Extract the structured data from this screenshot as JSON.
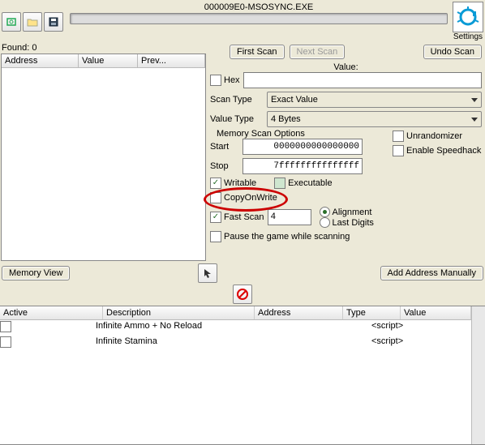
{
  "title": "000009E0-MSOSYNC.EXE",
  "found_label": "Found:",
  "found_count": "0",
  "result_columns": {
    "address": "Address",
    "value": "Value",
    "prev": "Prev..."
  },
  "logo_label": "Cheat Engine",
  "settings_label": "Settings",
  "buttons": {
    "first_scan": "First Scan",
    "next_scan": "Next Scan",
    "undo_scan": "Undo Scan",
    "memory_view": "Memory View",
    "add_addr": "Add Address Manually"
  },
  "scan": {
    "value_label": "Value:",
    "hex_label": "Hex",
    "hex_checked": false,
    "value_input": "",
    "scan_type_label": "Scan Type",
    "scan_type_value": "Exact Value",
    "value_type_label": "Value Type",
    "value_type_value": "4 Bytes",
    "mem_opt_label": "Memory Scan Options",
    "start_label": "Start",
    "start_value": "0000000000000000",
    "stop_label": "Stop",
    "stop_value": "7fffffffffffffff",
    "writable_label": "Writable",
    "writable_checked": true,
    "executable_label": "Executable",
    "executable_mixed": true,
    "cow_label": "CopyOnWrite",
    "cow_checked": false,
    "fastscan_label": "Fast Scan",
    "fastscan_checked": true,
    "fastscan_value": "4",
    "alignment_label": "Alignment",
    "lastdigits_label": "Last Digits",
    "pause_label": "Pause the game while scanning",
    "pause_checked": false,
    "unrandom_label": "Unrandomizer",
    "unrandom_checked": false,
    "speedhack_label": "Enable Speedhack",
    "speedhack_checked": false
  },
  "bottom_columns": {
    "active": "Active",
    "description": "Description",
    "address": "Address",
    "type": "Type",
    "value": "Value"
  },
  "entries": [
    {
      "active": false,
      "description": "Infinite Ammo + No Reload",
      "address": "",
      "type": "",
      "value": "<script>"
    },
    {
      "active": false,
      "description": "Infinite Stamina",
      "address": "",
      "type": "",
      "value": "<script>"
    }
  ],
  "col_widths": {
    "active": 118,
    "description": 178,
    "address": 100,
    "type": 62,
    "value": 100
  }
}
